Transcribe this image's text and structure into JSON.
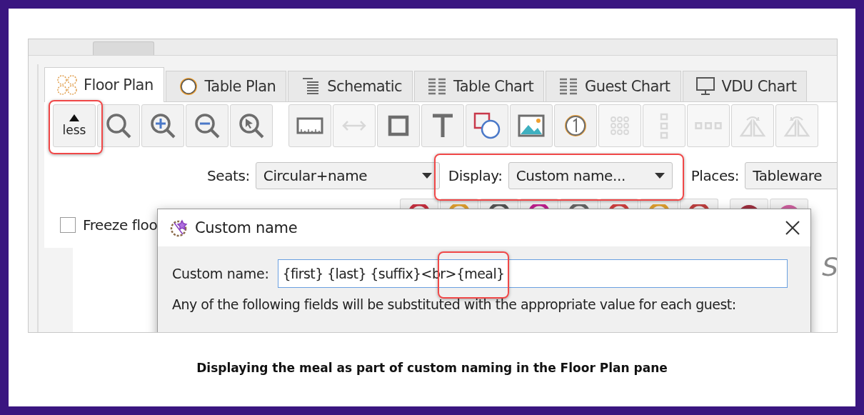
{
  "tabs": [
    {
      "label": "Floor Plan",
      "kind": "floor",
      "selected": true
    },
    {
      "label": "Table Plan",
      "kind": "table",
      "selected": false
    },
    {
      "label": "Schematic",
      "kind": "schematic",
      "selected": false
    },
    {
      "label": "Table Chart",
      "kind": "chart",
      "selected": false
    },
    {
      "label": "Guest Chart",
      "kind": "chart",
      "selected": false
    },
    {
      "label": "VDU Chart",
      "kind": "monitor",
      "selected": false
    }
  ],
  "toolbar": {
    "less_button": {
      "label": "less",
      "highlighted": true
    },
    "tools": [
      {
        "kind": "search",
        "disabled": false
      },
      {
        "kind": "zoom-in",
        "disabled": false
      },
      {
        "kind": "zoom-out",
        "disabled": false
      },
      {
        "kind": "zoom-select",
        "disabled": false
      },
      {
        "kind": "ruler",
        "disabled": false
      },
      {
        "kind": "double-arrow",
        "disabled": true
      },
      {
        "kind": "square",
        "disabled": false
      },
      {
        "kind": "text",
        "disabled": false
      },
      {
        "kind": "shapes",
        "disabled": false
      },
      {
        "kind": "image",
        "disabled": false
      },
      {
        "kind": "numbered-table",
        "disabled": false
      },
      {
        "kind": "dot-grid",
        "disabled": true
      },
      {
        "kind": "vertical-dots",
        "disabled": true
      },
      {
        "kind": "horizontal-dots",
        "disabled": true
      },
      {
        "kind": "flip-right",
        "disabled": true
      },
      {
        "kind": "flip-left",
        "disabled": true
      }
    ]
  },
  "options": [
    {
      "label": "Seats:",
      "value": "Circular+name",
      "highlighted": false
    },
    {
      "label": "Display:",
      "value": "Custom name...",
      "highlighted": true
    },
    {
      "label": "Places:",
      "value": "Tableware",
      "highlighted": false
    }
  ],
  "freeze": {
    "label": "Freeze floo",
    "checked": false
  },
  "canvas_text": "S",
  "dialog": {
    "title": "Custom name",
    "field_label": "Custom name:",
    "field_value": "{first} {last} {suffix}<br>{meal}",
    "highlighted": true,
    "description": "Any of the following fields will be substituted with the appropriate value for each guest:"
  },
  "caption": "Displaying the meal as part of custom naming in the Floor Plan pane"
}
